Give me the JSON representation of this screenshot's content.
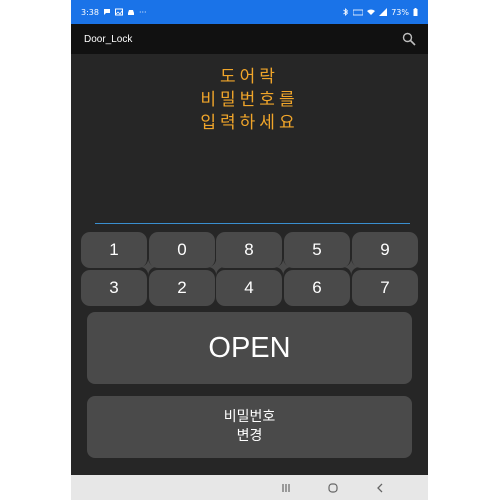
{
  "status_bar": {
    "time": "3:38",
    "left_icons": [
      "chat-bubble-icon",
      "image-icon",
      "car-icon"
    ],
    "more": "···",
    "battery": "73%"
  },
  "app_bar": {
    "title": "Door_Lock"
  },
  "prompt": {
    "lines": [
      "도어락",
      "비밀번호를",
      "입력하세요"
    ]
  },
  "pin_field": {
    "value": ""
  },
  "keypad": {
    "row1": [
      "1",
      "0",
      "8",
      "5",
      "9"
    ],
    "row2": [
      "3",
      "2",
      "4",
      "6",
      "7"
    ]
  },
  "open_button": {
    "label": "OPEN"
  },
  "change_password_button": {
    "lines": [
      "비밀번호",
      "변경"
    ]
  },
  "colors": {
    "accent_blue": "#1a73e8",
    "prompt_orange": "#f0a52a",
    "key_gray": "#4a4a4a",
    "background": "#262626"
  }
}
